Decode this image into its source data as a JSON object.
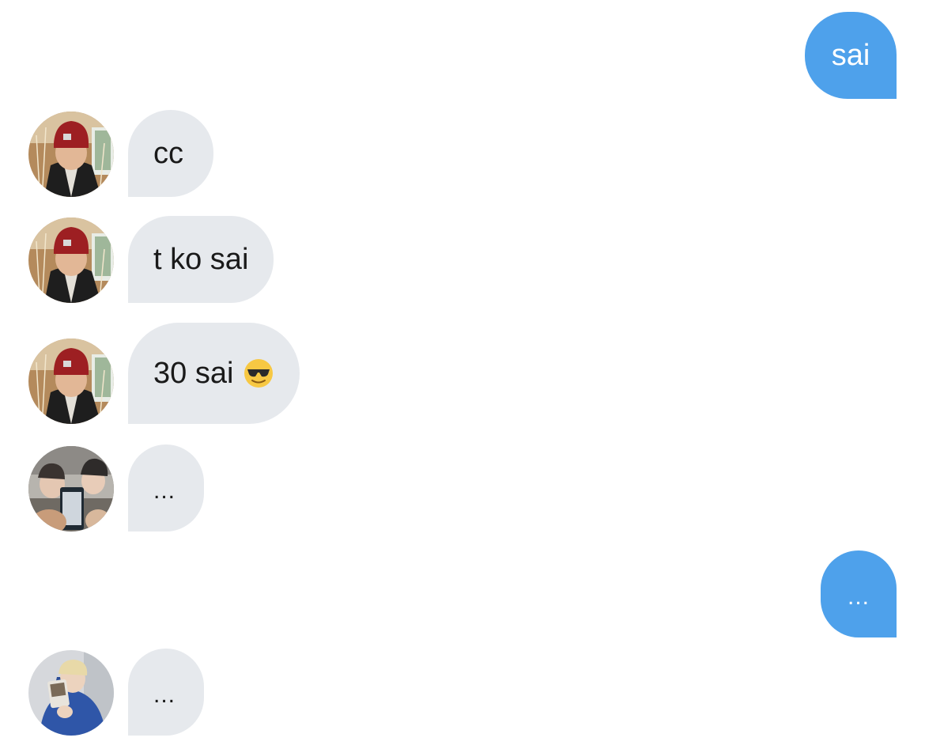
{
  "colors": {
    "incoming_bubble": "#e6e9ed",
    "outgoing_bubble": "#4ea1eb",
    "incoming_text": "#1a1a1a",
    "outgoing_text": "#ffffff"
  },
  "messages": [
    {
      "direction": "outgoing",
      "text": "sai"
    },
    {
      "direction": "incoming",
      "avatar": "avatar-red-beanie",
      "text": "cc"
    },
    {
      "direction": "incoming",
      "avatar": "avatar-red-beanie",
      "text": "t ko sai"
    },
    {
      "direction": "incoming",
      "avatar": "avatar-red-beanie",
      "text": "30 sai",
      "emoji": "smiling-face-with-sunglasses-icon"
    },
    {
      "direction": "incoming",
      "avatar": "avatar-group-photo",
      "text": "..."
    },
    {
      "direction": "outgoing",
      "text": "..."
    },
    {
      "direction": "incoming",
      "avatar": "avatar-blue-hoodie",
      "text": "..."
    }
  ]
}
